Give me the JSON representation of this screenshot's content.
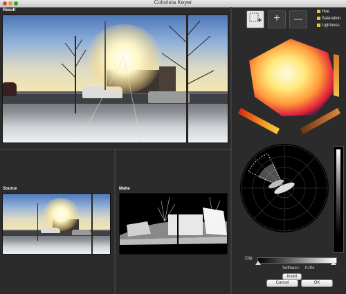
{
  "window": {
    "title": "Colorista Keyer"
  },
  "panels": {
    "result_label": "Result",
    "source_label": "Source",
    "matte_label": "Matte"
  },
  "legend": {
    "items": [
      {
        "label": "Hue",
        "color": "#e6c52a"
      },
      {
        "label": "Saturation",
        "color": "#e6c52a"
      },
      {
        "label": "Lightness",
        "color": "#e6c52a"
      }
    ]
  },
  "tools": {
    "add_symbol": "+",
    "subtract_symbol": "—"
  },
  "controls": {
    "clip_label": "Clip:",
    "softness_label": "Softness:",
    "softness_value": "0.0%",
    "invert_label": "Invert",
    "cancel_label": "Cancel",
    "ok_label": "OK"
  }
}
